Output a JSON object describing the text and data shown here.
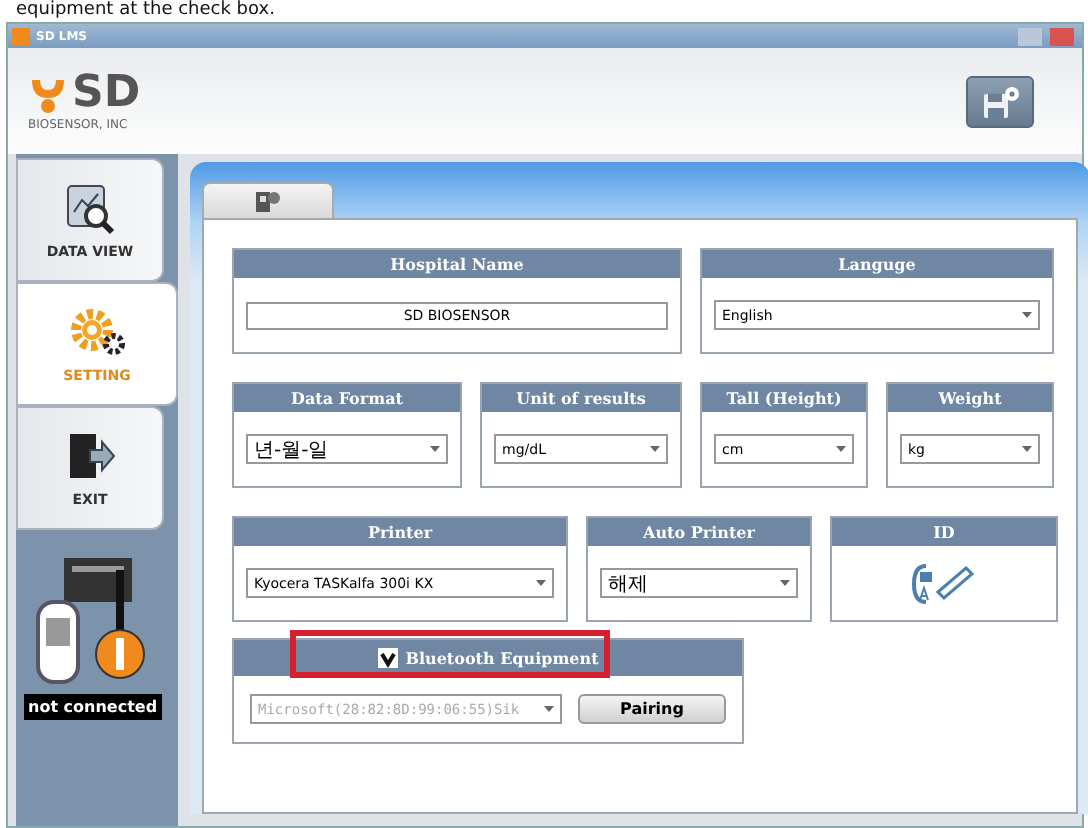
{
  "caption": "equipment at the check box.",
  "window": {
    "title": "SD LMS"
  },
  "logo": {
    "brand": "SD",
    "subtitle": "BIOSENSOR, INC"
  },
  "sidebar": {
    "items": [
      {
        "kind": "data",
        "label": "DATA VIEW",
        "selected": false
      },
      {
        "kind": "setting",
        "label": "SETTING",
        "selected": true
      },
      {
        "kind": "exit",
        "label": "EXIT",
        "selected": false
      }
    ],
    "device_status": "not connected"
  },
  "rows": [
    [
      {
        "kind": "text",
        "title": "Hospital Name",
        "value": "SD BIOSENSOR"
      },
      {
        "kind": "select",
        "title": "Languge",
        "value": "English"
      }
    ],
    [
      {
        "kind": "select",
        "title": "Data Format",
        "value": "년-월-일"
      },
      {
        "kind": "select",
        "title": "Unit of results",
        "value": "mg/dL"
      },
      {
        "kind": "select",
        "title": "Tall (Height)",
        "value": "cm"
      },
      {
        "kind": "select",
        "title": "Weight",
        "value": "kg"
      }
    ],
    [
      {
        "kind": "select",
        "title": "Printer",
        "value": "Kyocera TASKalfa 300i KX"
      },
      {
        "kind": "select",
        "title": "Auto Printer",
        "value": "해제"
      },
      {
        "kind": "icon",
        "title": "ID"
      }
    ],
    [
      {
        "kind": "bluetooth",
        "title": "Bluetooth Equipment",
        "checked": true,
        "highlighted": true,
        "value": "Microsoft(28:82:8D:99:06:55)Sik",
        "button": "Pairing"
      }
    ]
  ]
}
